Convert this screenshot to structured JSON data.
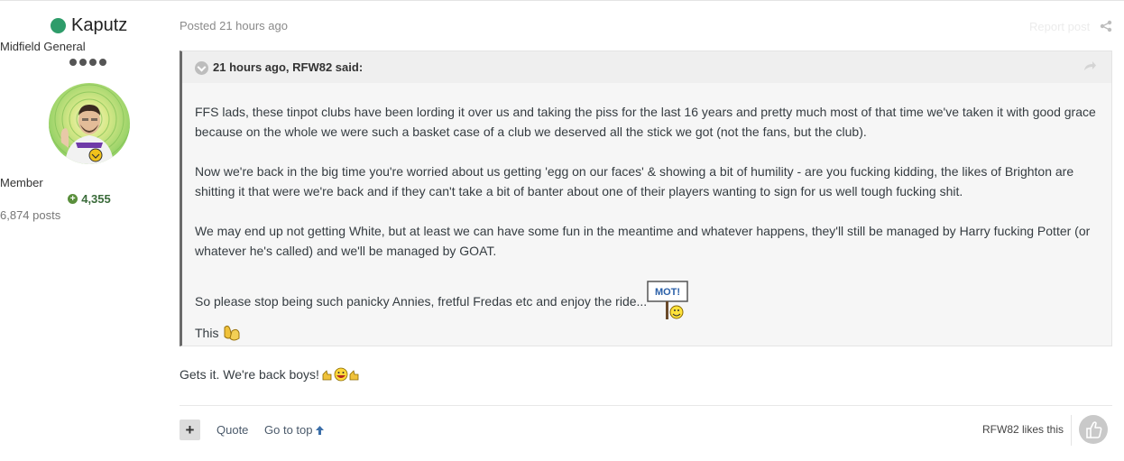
{
  "author": {
    "name": "Kaputz",
    "title": "Midfield General",
    "group": "Member",
    "reputation": "4,355",
    "posts": "6,874 posts",
    "online_color": "#2e9c6a"
  },
  "post": {
    "posted": "Posted 21 hours ago",
    "report": "Report post"
  },
  "quote": {
    "cite": "21 hours ago, RFW82 said:",
    "paragraphs": [
      "FFS lads, these tinpot clubs have been lording it over us and taking the piss for the last 16 years and pretty much most of that time we've taken it with good grace because on the whole we were such a basket case of a club we deserved all the stick we got (not the fans, but the club).",
      "Now we're back in the big time you're worried about us getting 'egg on our faces' & showing a bit of humility - are you fucking kidding, the likes of Brighton are shitting it that were we're back and if they can't take a bit of banter about one of their players wanting to sign for us well tough fucking shit.",
      "We may end up not getting White, but at least we can have some fun in the meantime and whatever happens, they'll still be managed by Harry fucking Potter (or whatever he's called) and we'll be managed by GOAT.",
      "So please stop being such panicky Annies, fretful Fredas etc and enjoy the ride..."
    ],
    "this_text": "This",
    "sign_text": "MOT!"
  },
  "reply": {
    "text": "Gets it. We're back boys!"
  },
  "footer": {
    "plus": "+",
    "quote": "Quote",
    "go_to_top": "Go to top",
    "likes": "RFW82 likes this"
  }
}
